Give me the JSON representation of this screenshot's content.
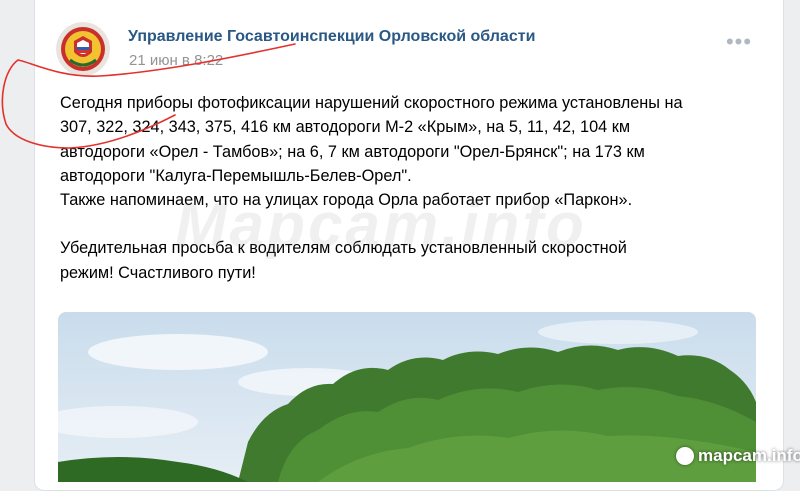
{
  "post": {
    "author": "Управление Госавтоинспекции Орловской области",
    "time": "21 июн в 8:22",
    "more_icon": "more-horizontal-icon",
    "text_lines": [
      "Сегодня приборы фотофиксации нарушений скоростного режима установлены на",
      "307, 322, 324, 343, 375, 416 км автодороги М-2 «Крым», на 5, 11, 42, 104 км",
      "автодороги «Орел - Тамбов»; на 6, 7 км автодороги \"Орел-Брянск\"; на 173 км",
      "автодороги \"Калуга-Перемышль-Белев-Орел\".",
      "Также напоминаем, что на улицах города Орла работает прибор «Паркон».",
      "Убедительная просьба к водителям соблюдать установленный скоростной",
      "режим! Счастливого пути!"
    ]
  },
  "watermark": {
    "main": "Mapcam.info",
    "corner": "mapcam.info"
  },
  "colors": {
    "author_link": "#2a5885",
    "annotation": "#e3312d",
    "page_bg": "#edeef0"
  }
}
